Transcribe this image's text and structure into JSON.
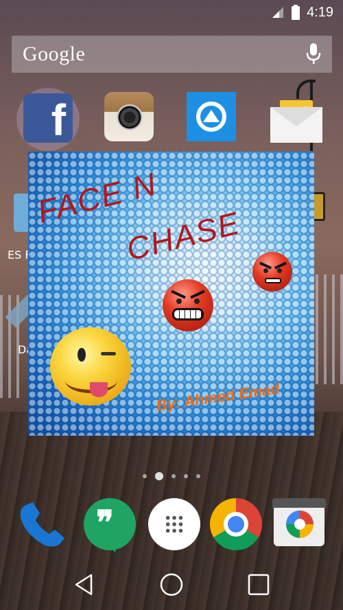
{
  "status_bar": {
    "time": "4:19",
    "icons": [
      "signal-icon",
      "battery-icon"
    ]
  },
  "search": {
    "logo_text": "Google",
    "icon": "mic-icon"
  },
  "apps_top_row": [
    {
      "name": "Facebook",
      "icon": "facebook-icon"
    },
    {
      "name": "Instagram",
      "icon": "instagram-icon"
    },
    {
      "name": "QuickPic",
      "icon": "quickpic-icon"
    },
    {
      "name": "Email",
      "icon": "email-icon"
    }
  ],
  "side_labels": {
    "left_1": "ES F",
    "left_2": "Da"
  },
  "widget": {
    "title_line1": "FACE N",
    "title_line2": "CHASE",
    "byline": "By: Ahmed Emad"
  },
  "pages": {
    "count": 5,
    "active_index": 1
  },
  "dock": [
    {
      "name": "Phone",
      "icon": "phone-icon"
    },
    {
      "name": "Hangouts",
      "icon": "hangouts-icon"
    },
    {
      "name": "Apps",
      "icon": "app-drawer-icon"
    },
    {
      "name": "Chrome",
      "icon": "chrome-icon"
    },
    {
      "name": "Camera",
      "icon": "camera-icon"
    }
  ],
  "nav": [
    "back-icon",
    "home-icon",
    "recents-icon"
  ],
  "colors": {
    "title_red": "#b0181c",
    "byline_orange": "#ef6a12",
    "facebook_blue": "#3b5998",
    "hangouts_green": "#1fa463"
  }
}
